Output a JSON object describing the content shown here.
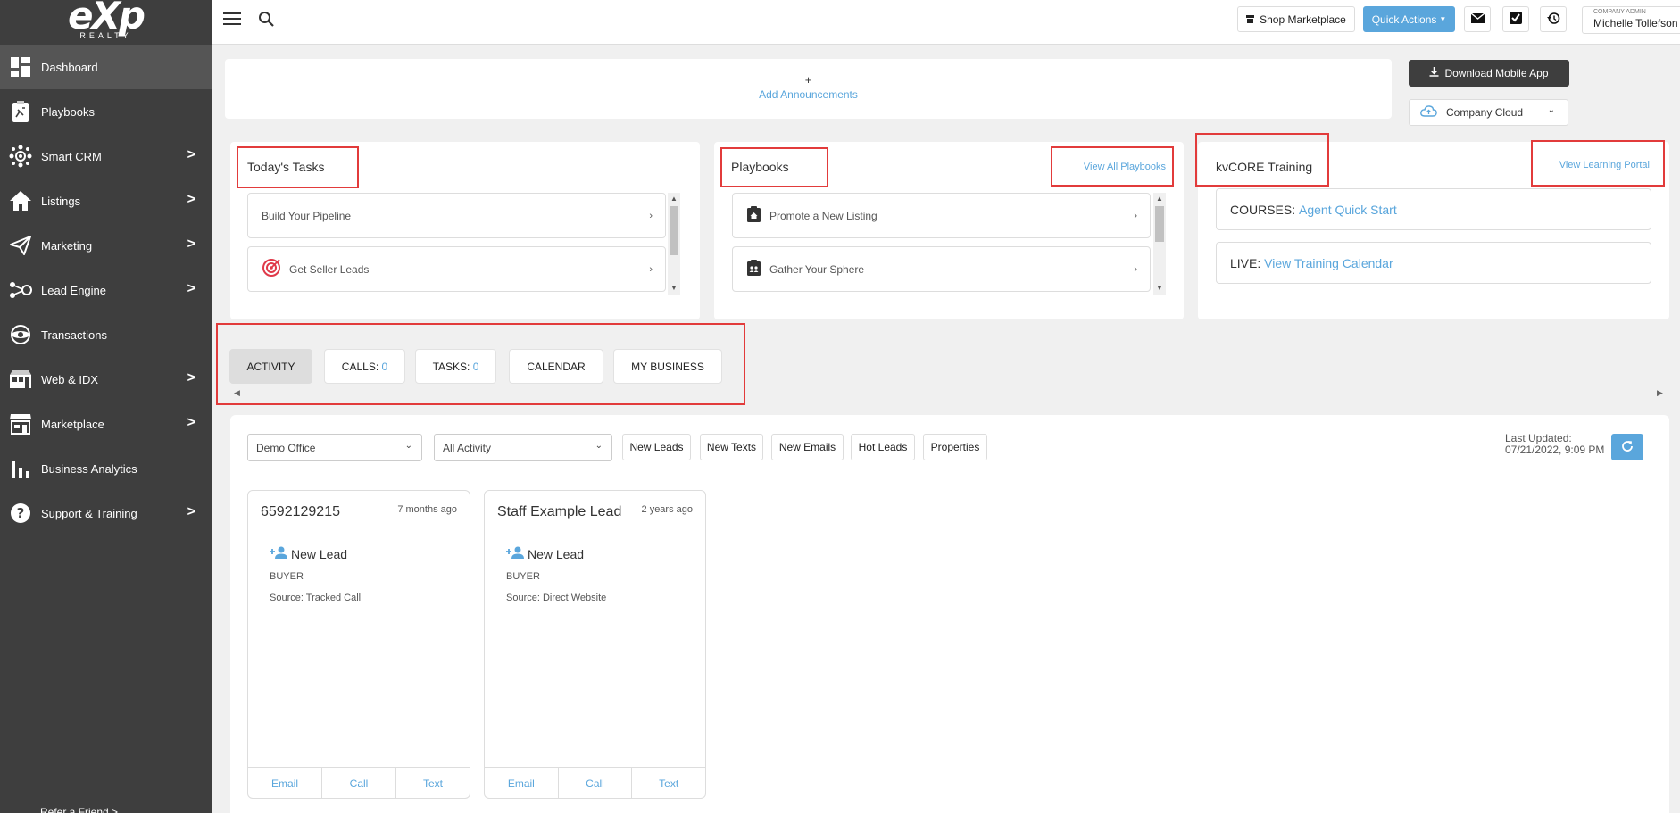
{
  "brand": {
    "logo_main": "eXp",
    "logo_sub": "REALTY"
  },
  "sidebar": {
    "items": [
      {
        "label": "Dashboard",
        "icon": "dashboard-icon",
        "submenu": false
      },
      {
        "label": "Playbooks",
        "icon": "playbook-icon",
        "submenu": false
      },
      {
        "label": "Smart CRM",
        "icon": "crm-icon",
        "submenu": true
      },
      {
        "label": "Listings",
        "icon": "home-icon",
        "submenu": true
      },
      {
        "label": "Marketing",
        "icon": "paper-plane-icon",
        "submenu": true
      },
      {
        "label": "Lead Engine",
        "icon": "lead-engine-icon",
        "submenu": true
      },
      {
        "label": "Transactions",
        "icon": "transactions-icon",
        "submenu": false
      },
      {
        "label": "Web & IDX",
        "icon": "web-idx-icon",
        "submenu": true
      },
      {
        "label": "Marketplace",
        "icon": "store-icon",
        "submenu": true
      },
      {
        "label": "Business Analytics",
        "icon": "bar-chart-icon",
        "submenu": false
      },
      {
        "label": "Support & Training",
        "icon": "help-icon",
        "submenu": true
      }
    ],
    "refer": "Refer a Friend",
    "refer_chevron": ">",
    "chevron": ">"
  },
  "topbar": {
    "menu_icon": "hamburger-icon",
    "search_icon": "search-icon",
    "shop_marketplace": "Shop Marketplace",
    "quick_actions": "Quick Actions",
    "user_role": "COMPANY ADMIN",
    "user_name": "Michelle Tollefson"
  },
  "announcements": {
    "plus": "+",
    "label": "Add Announcements"
  },
  "download_app": "Download Mobile App",
  "company_cloud": "Company Cloud",
  "tasks": {
    "title": "Today's Tasks",
    "items": [
      {
        "label": "Build Your Pipeline"
      },
      {
        "label": "Get Seller Leads"
      }
    ]
  },
  "playbooks": {
    "title": "Playbooks",
    "view_all": "View All Playbooks",
    "items": [
      {
        "label": "Promote a New Listing"
      },
      {
        "label": "Gather Your Sphere"
      }
    ]
  },
  "training": {
    "title": "kvCORE Training",
    "view_portal": "View Learning Portal",
    "courses_prefix": "COURSES:",
    "courses_link": "Agent Quick Start",
    "live_prefix": "LIVE:",
    "live_link": "View Training Calendar"
  },
  "row_arrow": "›",
  "tabs": {
    "activity": "ACTIVITY",
    "calls": "CALLS:",
    "calls_count": "0",
    "tasks": "TASKS:",
    "tasks_count": "0",
    "calendar": "CALENDAR",
    "my_business": "MY BUSINESS"
  },
  "filters": {
    "office": "Demo Office",
    "activity": "All Activity",
    "buttons": [
      "New Leads",
      "New Texts",
      "New Emails",
      "Hot Leads",
      "Properties"
    ],
    "last_updated_label": "Last Updated:",
    "last_updated_value": "07/21/2022, 9:09 PM"
  },
  "leads": [
    {
      "name": "6592129215",
      "ago": "7 months ago",
      "event": "New Lead",
      "type": "BUYER",
      "source": "Source: Tracked Call"
    },
    {
      "name": "Staff Example Lead",
      "ago": "2 years ago",
      "event": "New Lead",
      "type": "BUYER",
      "source": "Source: Direct Website"
    }
  ],
  "lead_actions": [
    "Email",
    "Call",
    "Text"
  ],
  "colors": {
    "sidebar": "#3e3e3e",
    "accent": "#5aa6dc",
    "highlight": "#e23b3b",
    "quick_actions": "#5aa6dc"
  }
}
